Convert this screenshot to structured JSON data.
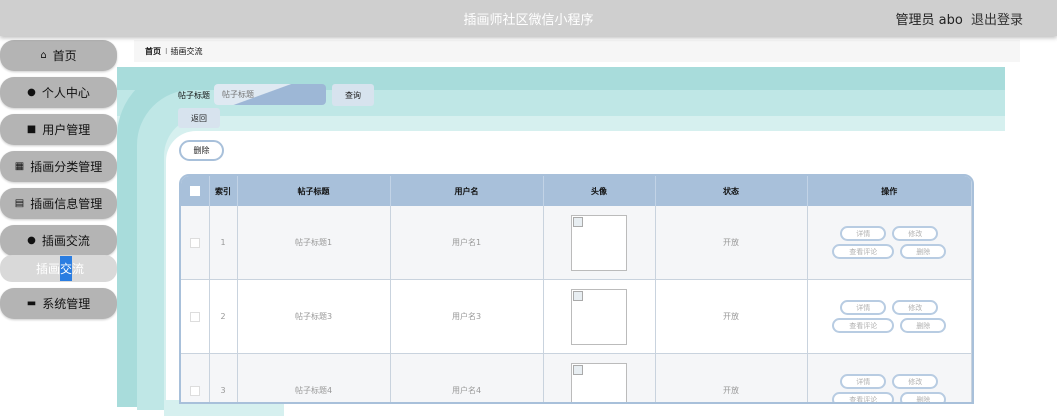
{
  "header": {
    "title": "插画师社区微信小程序",
    "user": "管理员 abo",
    "logout": "退出登录"
  },
  "sidebar": {
    "items": [
      {
        "label": "首页",
        "icon": "home-icon",
        "glyph": "⌂"
      },
      {
        "label": "个人中心",
        "icon": "user-icon",
        "glyph": "●"
      },
      {
        "label": "用户管理",
        "icon": "briefcase-icon",
        "glyph": "■"
      },
      {
        "label": "插画分类管理",
        "icon": "grid-icon",
        "glyph": "▦"
      },
      {
        "label": "插画信息管理",
        "icon": "document-icon",
        "glyph": "▤"
      },
      {
        "label": "插画交流",
        "icon": "location-pin-icon",
        "glyph": "●"
      },
      {
        "label": "系统管理",
        "icon": "printer-icon",
        "glyph": "▬"
      }
    ],
    "sub_item_prefix": "插画",
    "sub_item_highlight": "交",
    "sub_item_suffix": "流"
  },
  "breadcrumb": {
    "home": "首页",
    "sep": "⁝",
    "current": "插画交流"
  },
  "search": {
    "label": "帖子标题",
    "placeholder": "帖子标题",
    "query_button": "查询",
    "back_button": "返回"
  },
  "toolbar": {
    "delete_button": "删除"
  },
  "table": {
    "headers": [
      "索引",
      "帖子标题",
      "用户名",
      "头像",
      "状态",
      "操作"
    ],
    "rows": [
      {
        "index": "1",
        "title": "帖子标题1",
        "username": "用户名1",
        "status": "开放"
      },
      {
        "index": "2",
        "title": "帖子标题3",
        "username": "用户名3",
        "status": "开放"
      },
      {
        "index": "3",
        "title": "帖子标题4",
        "username": "用户名4",
        "status": "开放"
      }
    ],
    "actions": {
      "detail": "详情",
      "edit": "修改",
      "view_comments": "查看评论",
      "delete": "删除"
    }
  },
  "colors": {
    "topbar": "#cfcfcf",
    "menu": "#b4b4b4",
    "accent_teal": "#a8dcdb",
    "table_header": "#a8c0da",
    "highlight": "#2a7de1"
  }
}
